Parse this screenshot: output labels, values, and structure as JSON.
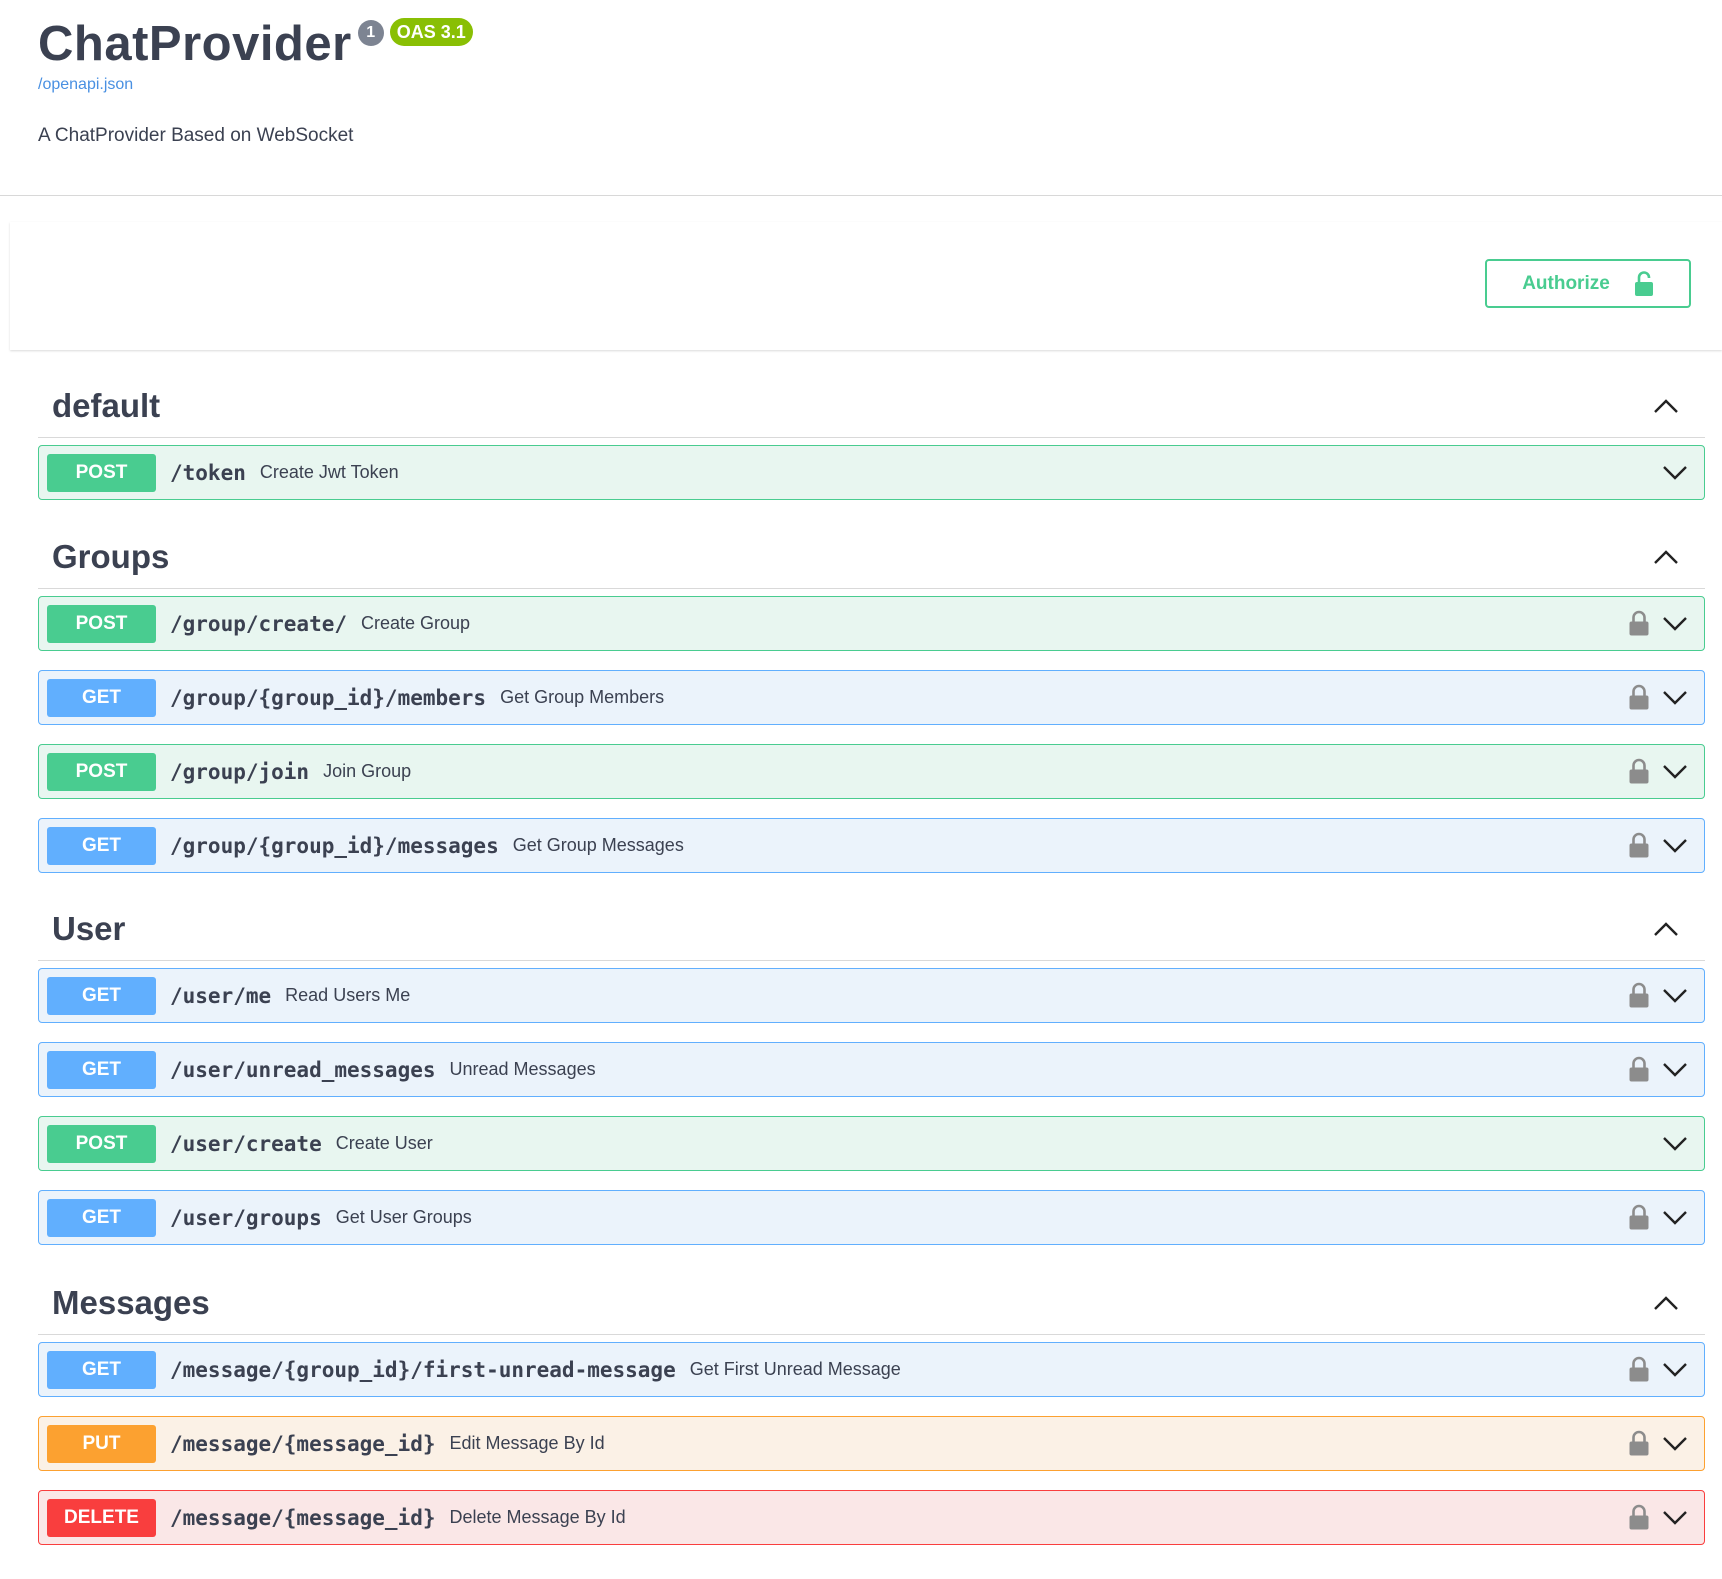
{
  "info": {
    "title": "ChatProvider",
    "version": "1",
    "oas_badge": "OAS 3.1",
    "spec_link": "/openapi.json",
    "description": "A ChatProvider Based on WebSocket"
  },
  "authorize": {
    "label": "Authorize"
  },
  "colors": {
    "post": "#49cc90",
    "get": "#61affe",
    "put": "#fca130",
    "delete": "#f93e3e",
    "oas_badge": "#89bf04"
  },
  "sections": [
    {
      "name": "default",
      "operations": [
        {
          "method": "POST",
          "path": "/token",
          "summary": "Create Jwt Token",
          "locked": false
        }
      ]
    },
    {
      "name": "Groups",
      "operations": [
        {
          "method": "POST",
          "path": "/group/create/",
          "summary": "Create Group",
          "locked": true
        },
        {
          "method": "GET",
          "path": "/group/{group_id}/members",
          "summary": "Get Group Members",
          "locked": true
        },
        {
          "method": "POST",
          "path": "/group/join",
          "summary": "Join Group",
          "locked": true
        },
        {
          "method": "GET",
          "path": "/group/{group_id}/messages",
          "summary": "Get Group Messages",
          "locked": true
        }
      ]
    },
    {
      "name": "User",
      "operations": [
        {
          "method": "GET",
          "path": "/user/me",
          "summary": "Read Users Me",
          "locked": true
        },
        {
          "method": "GET",
          "path": "/user/unread_messages",
          "summary": "Unread Messages",
          "locked": true
        },
        {
          "method": "POST",
          "path": "/user/create",
          "summary": "Create User",
          "locked": false
        },
        {
          "method": "GET",
          "path": "/user/groups",
          "summary": "Get User Groups",
          "locked": true
        }
      ]
    },
    {
      "name": "Messages",
      "operations": [
        {
          "method": "GET",
          "path": "/message/{group_id}/first-unread-message",
          "summary": "Get First Unread Message",
          "locked": true
        },
        {
          "method": "PUT",
          "path": "/message/{message_id}",
          "summary": "Edit Message By Id",
          "locked": true
        },
        {
          "method": "DELETE",
          "path": "/message/{message_id}",
          "summary": "Delete Message By Id",
          "locked": true
        }
      ]
    }
  ]
}
